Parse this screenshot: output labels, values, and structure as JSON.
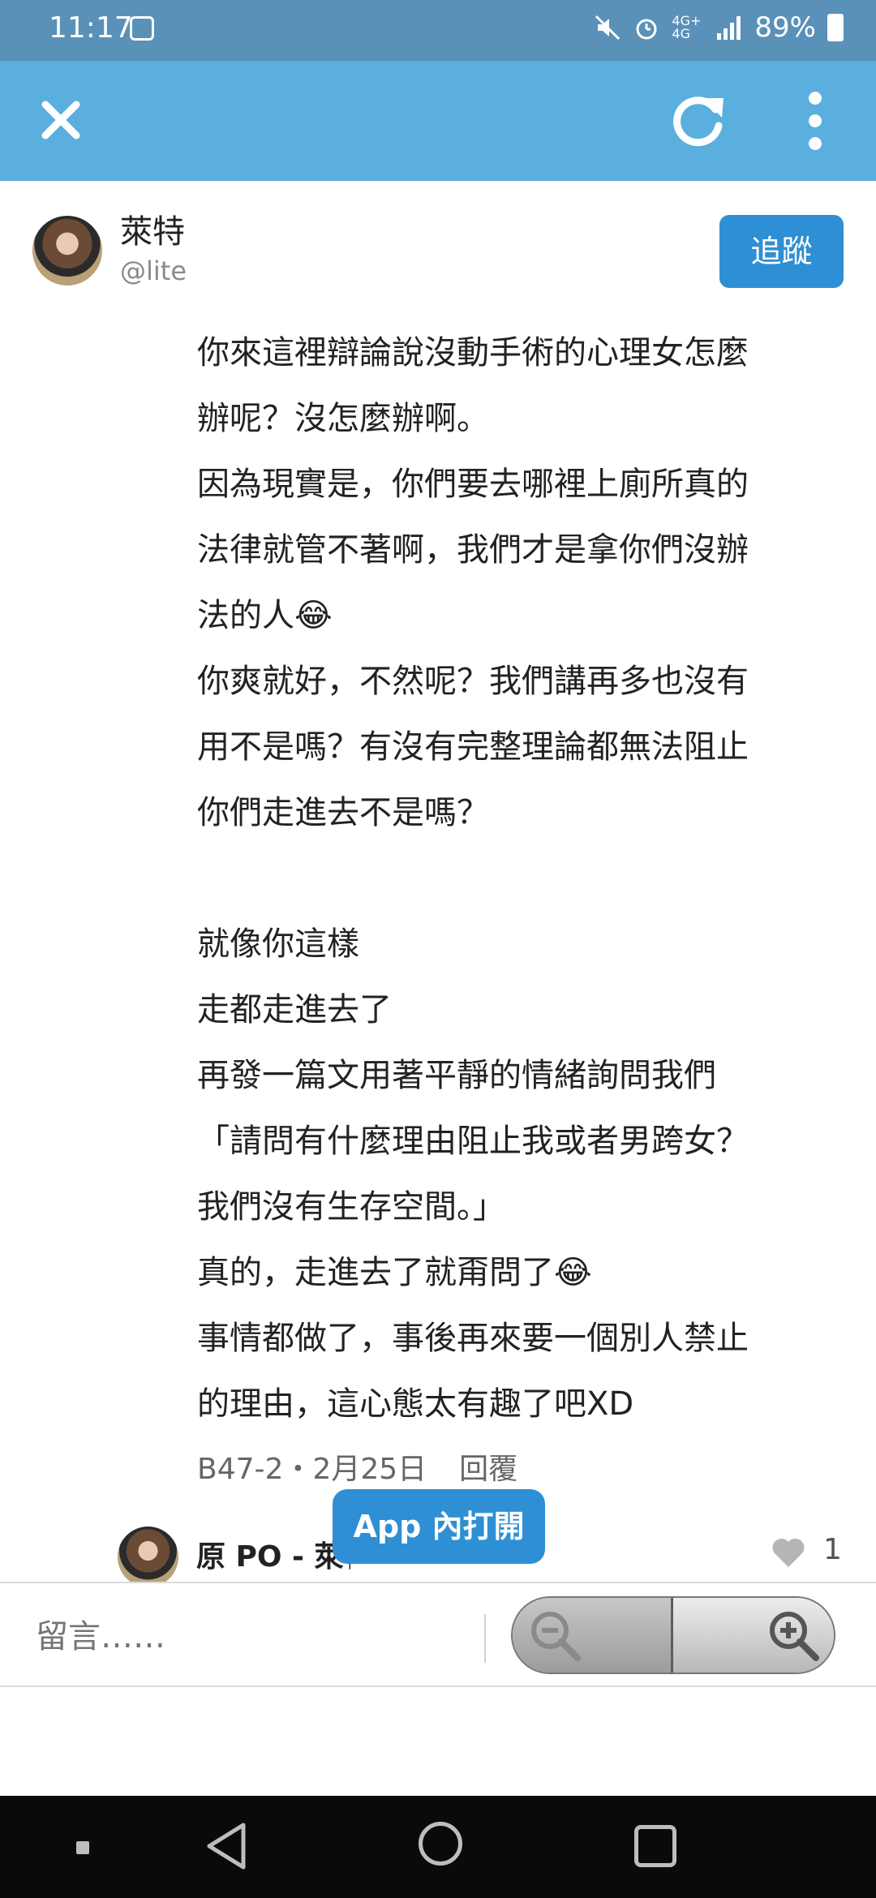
{
  "status_bar": {
    "time": "11:17",
    "network": "4G+ 4G",
    "battery": "89%"
  },
  "author": {
    "name": "萊特",
    "handle": "@lite",
    "follow_label": "追蹤"
  },
  "comment": {
    "lines": [
      "你來這裡辯論說沒動手術的心理女怎麼",
      "辦呢？沒怎麼辦啊。",
      "因為現實是，你們要去哪裡上廁所真的",
      "法律就管不著啊，我們才是拿你們沒辦",
      "法的人",
      "你爽就好，不然呢？我們講再多也沒有",
      "用不是嗎？有沒有完整理論都無法阻止",
      "你們走進去不是嗎？",
      "",
      "就像你這樣",
      "走都走進去了",
      "再發一篇文用著平靜的情緒詢問我們",
      "「請問有什麼理由阻止我或者男跨女？",
      "我們沒有生存空間。」",
      "真的，走進去了就甭問了",
      "事情都做了，事後再來要一個別人禁止",
      "的理由，這心態太有趣了吧XD"
    ],
    "emoji": "😂",
    "floor": "B47-2",
    "date": "2月25日",
    "reply_label": "回覆"
  },
  "reply": {
    "author": "原 PO - 萊特",
    "like_count": "1"
  },
  "app_open_label": "App 內打開",
  "comment_bar": {
    "placeholder": "留言……"
  },
  "colors": {
    "status_bar": "#5a91b8",
    "topbar": "#5aafde",
    "primary_button": "#2e8fd4"
  }
}
